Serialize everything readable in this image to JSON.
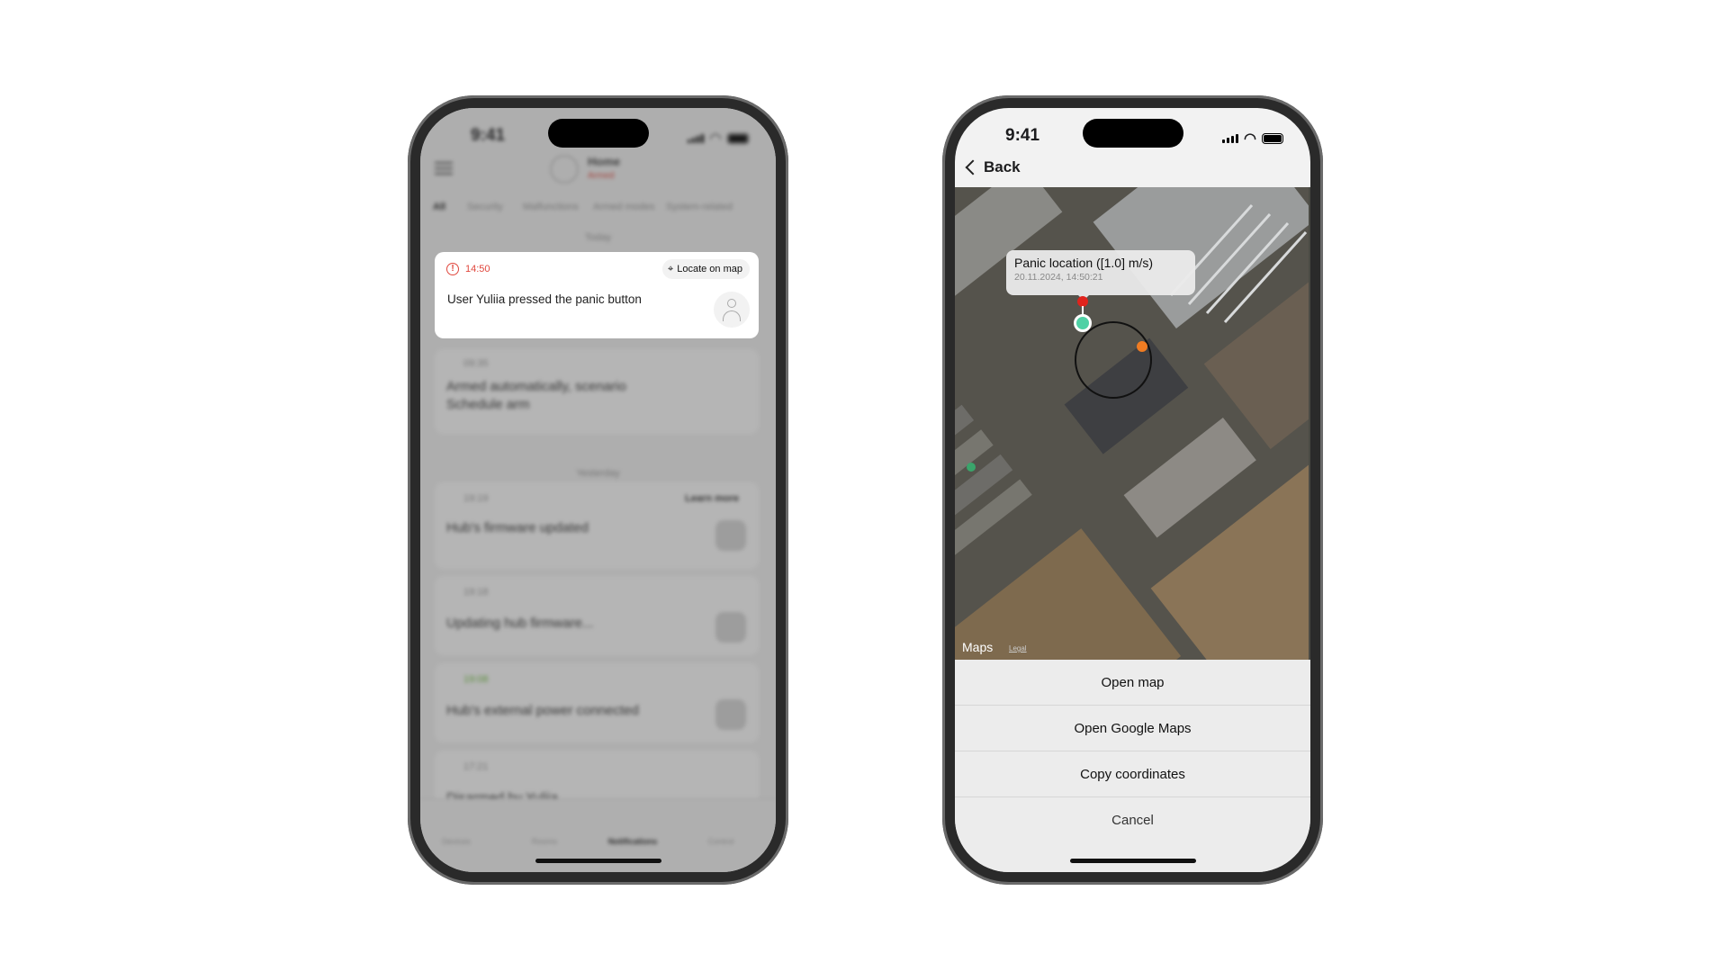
{
  "left_phone": {
    "status": {
      "time": "9:41"
    },
    "header": {
      "hub_name": "Home",
      "hub_state": "Armed"
    },
    "filter_tabs": [
      "All",
      "Security",
      "Malfunctions",
      "Armed modes",
      "System-related"
    ],
    "sections": {
      "today": "Today",
      "yesterday": "Yesterday"
    },
    "highlighted_event": {
      "time": "14:50",
      "text": "User Yuliia pressed the panic button",
      "action": "Locate on map",
      "accent": "#e0463c"
    },
    "events": [
      {
        "time": "09:35",
        "text": "Armed automatically, scenario Schedule arm"
      },
      {
        "time": "19:19",
        "text": "Hub's firmware updated",
        "action": "Learn more"
      },
      {
        "time": "19:18",
        "text": "Updating hub firmware..."
      },
      {
        "time": "19:08",
        "text": "Hub's external power connected"
      },
      {
        "time": "17:21",
        "text": "Disarmed by Yuliia"
      }
    ],
    "bottom_tabs": [
      "Devices",
      "Rooms",
      "Notifications",
      "Control"
    ],
    "active_tab": "Notifications"
  },
  "right_phone": {
    "status": {
      "time": "9:41"
    },
    "nav": {
      "back": "Back"
    },
    "map": {
      "callout_title": "Panic location ([1.0] m/s)",
      "callout_subtitle": "20.11.2024, 14:50:21",
      "attribution": "Maps",
      "legal": "Legal",
      "pin_color": "#e0231c",
      "location_color": "#4fd1a5"
    },
    "actions": [
      "Open map",
      "Open Google Maps",
      "Copy coordinates",
      "Cancel"
    ]
  }
}
